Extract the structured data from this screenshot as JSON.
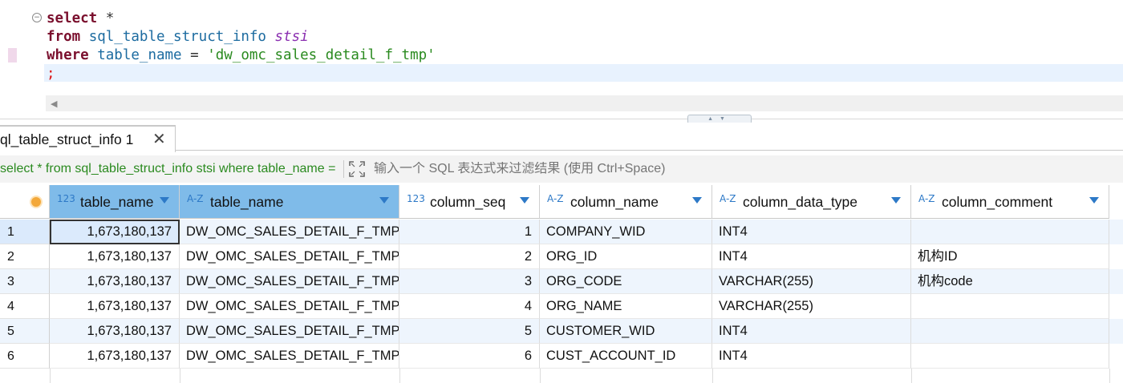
{
  "editor": {
    "sql_lines": [
      [
        {
          "t": "select",
          "c": "kw"
        },
        {
          "t": " *",
          "c": "op"
        }
      ],
      [
        {
          "t": "from",
          "c": "kw"
        },
        {
          "t": " ",
          "c": "op"
        },
        {
          "t": "sql_table_struct_info",
          "c": "id"
        },
        {
          "t": " ",
          "c": "op"
        },
        {
          "t": "stsi",
          "c": "alias"
        }
      ],
      [
        {
          "t": "where",
          "c": "kw"
        },
        {
          "t": " ",
          "c": "op"
        },
        {
          "t": "table_name",
          "c": "id"
        },
        {
          "t": " = ",
          "c": "op"
        },
        {
          "t": "'dw_omc_sales_detail_f_tmp'",
          "c": "str"
        }
      ],
      [
        {
          "t": ";",
          "c": "semi"
        }
      ]
    ]
  },
  "results": {
    "tab_label": "ql_table_struct_info 1",
    "query_text": "select * from sql_table_struct_info stsi where table_name = 'dw_omc_sales_detail_f_tmp'",
    "filter_placeholder": "输入一个 SQL 表达式来过滤结果 (使用 Ctrl+Space)",
    "columns": [
      {
        "type": "123",
        "name": "table_name",
        "selected": true
      },
      {
        "type": "A-Z",
        "name": "table_name",
        "selected": true
      },
      {
        "type": "123",
        "name": "column_seq",
        "selected": false
      },
      {
        "type": "A-Z",
        "name": "column_name",
        "selected": false
      },
      {
        "type": "A-Z",
        "name": "column_data_type",
        "selected": false
      },
      {
        "type": "A-Z",
        "name": "column_comment",
        "selected": false
      }
    ],
    "rows": [
      {
        "n": "1",
        "cells": [
          "1,673,180,137",
          "DW_OMC_SALES_DETAIL_F_TMP",
          "1",
          "COMPANY_WID",
          "INT4",
          ""
        ]
      },
      {
        "n": "2",
        "cells": [
          "1,673,180,137",
          "DW_OMC_SALES_DETAIL_F_TMP",
          "2",
          "ORG_ID",
          "INT4",
          "机构ID"
        ]
      },
      {
        "n": "3",
        "cells": [
          "1,673,180,137",
          "DW_OMC_SALES_DETAIL_F_TMP",
          "3",
          "ORG_CODE",
          "VARCHAR(255)",
          "机构code"
        ]
      },
      {
        "n": "4",
        "cells": [
          "1,673,180,137",
          "DW_OMC_SALES_DETAIL_F_TMP",
          "4",
          "ORG_NAME",
          "VARCHAR(255)",
          ""
        ]
      },
      {
        "n": "5",
        "cells": [
          "1,673,180,137",
          "DW_OMC_SALES_DETAIL_F_TMP",
          "5",
          "CUSTOMER_WID",
          "INT4",
          ""
        ]
      },
      {
        "n": "6",
        "cells": [
          "1,673,180,137",
          "DW_OMC_SALES_DETAIL_F_TMP",
          "6",
          "CUST_ACCOUNT_ID",
          "INT4",
          ""
        ]
      }
    ]
  },
  "colors": {
    "selected_header": "#7fbbe9",
    "alt_row": "#eef5fd",
    "keyword": "#7a0f2d",
    "identifier": "#1c6ba0",
    "string": "#2a8a1f"
  }
}
